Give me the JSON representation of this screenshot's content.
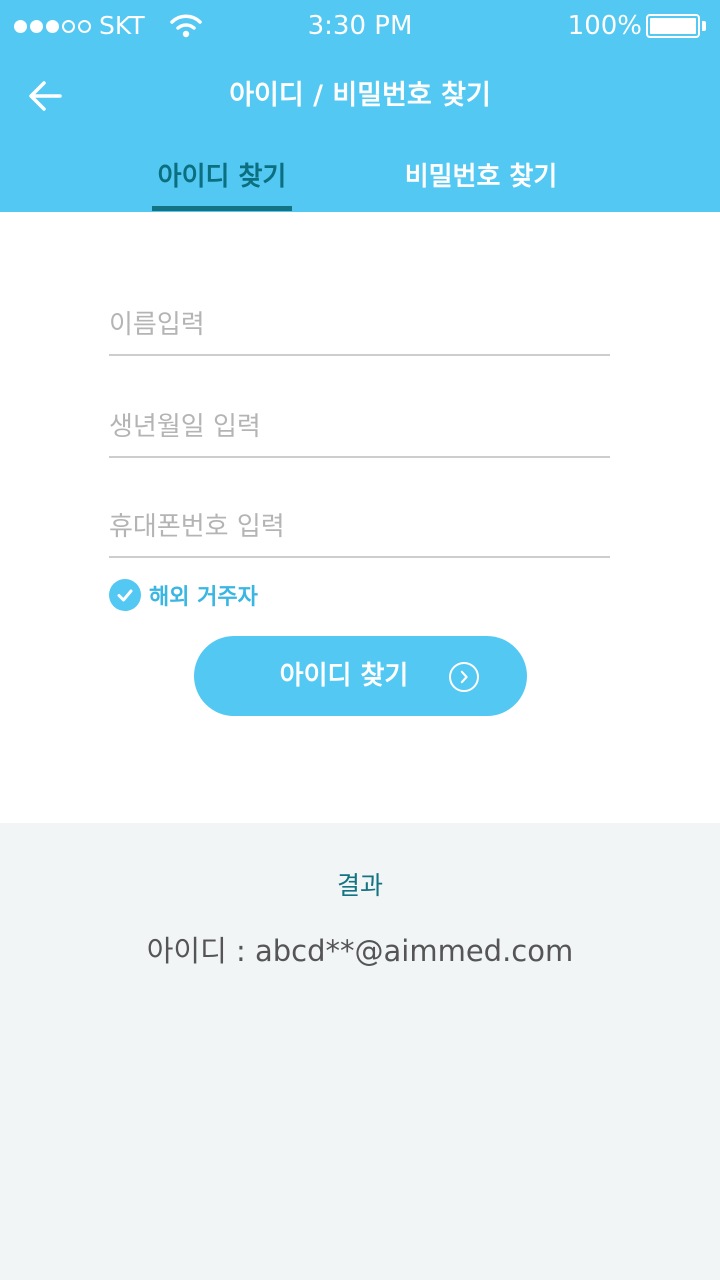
{
  "status_bar": {
    "carrier": "SKT",
    "time": "3:30 PM",
    "battery": "100%",
    "signal_bars_filled": 3,
    "signal_bars_total": 5
  },
  "header": {
    "title": "아이디 / 비밀번호 찾기",
    "back_icon": "arrow-left-icon"
  },
  "tabs": [
    {
      "label": "아이디 찾기",
      "active": true
    },
    {
      "label": "비밀번호 찾기",
      "active": false
    }
  ],
  "form": {
    "name_placeholder": "이름입력",
    "birthdate_placeholder": "생년월일 입력",
    "phone_placeholder": "휴대폰번호 입력",
    "overseas_label": "해외 거주자",
    "overseas_checked": true,
    "submit_label": "아이디 찾기",
    "submit_icon": "chevron-right-circle-icon"
  },
  "result": {
    "title": "결과",
    "value": "아이디 : abcd**@aimmed.com"
  },
  "colors": {
    "primary": "#52c8f3",
    "active_tab": "#0b6f7f",
    "indicator": "#137383",
    "result_bg": "#f1f5f6"
  }
}
